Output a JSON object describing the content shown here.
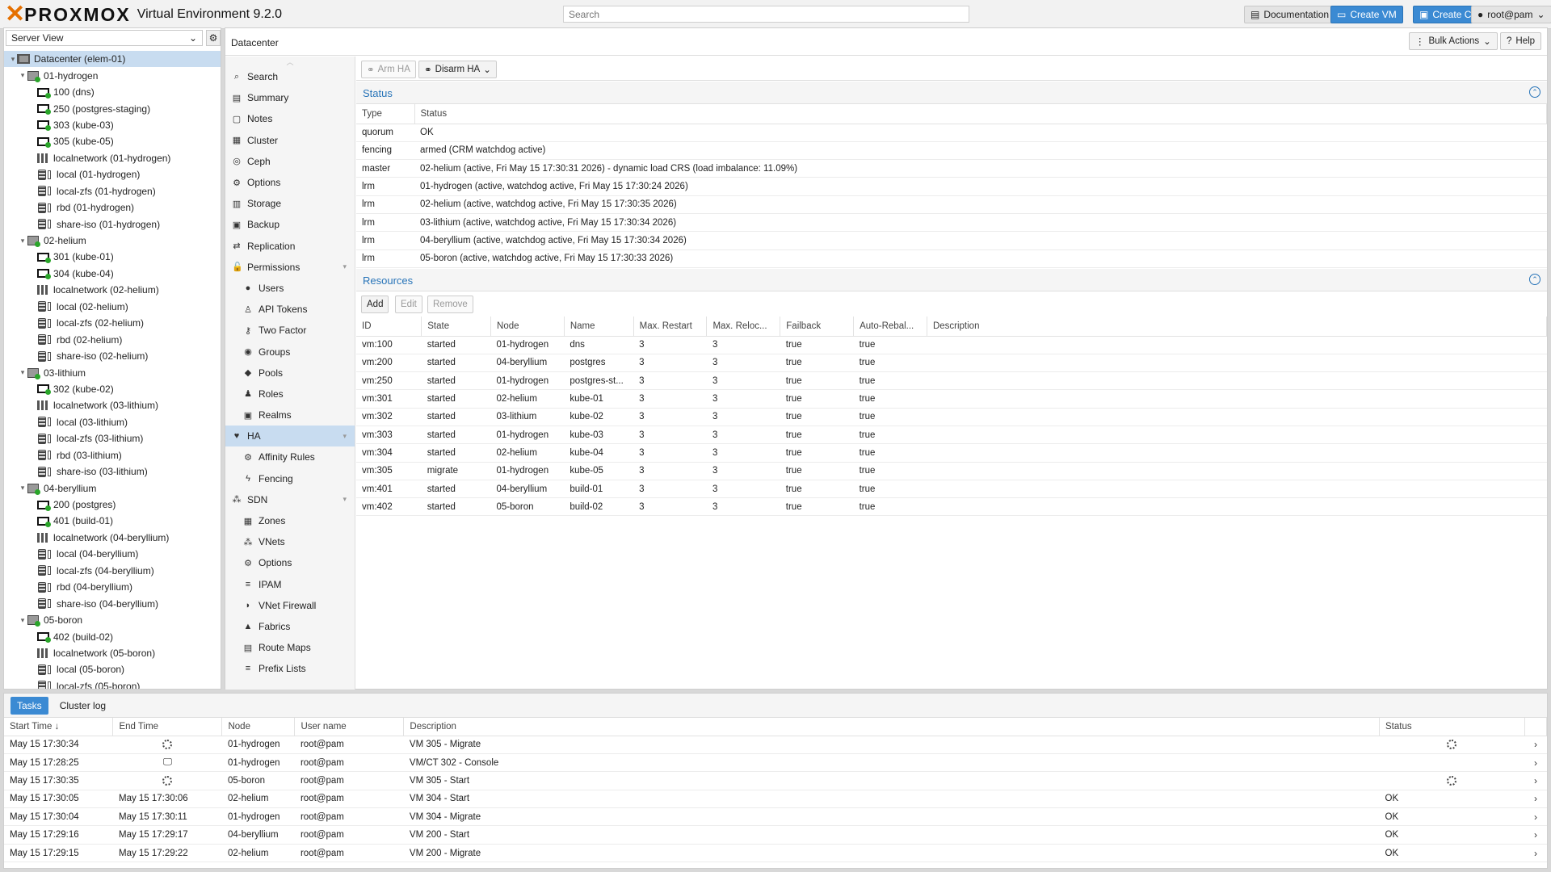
{
  "header": {
    "brand": "PROXMOX",
    "product": "Virtual Environment 9.2.0",
    "search_placeholder": "Search",
    "documentation": "Documentation",
    "create_vm": "Create VM",
    "create_ct": "Create CT",
    "user": "root@pam"
  },
  "tree": {
    "view": "Server View",
    "items": [
      {
        "label": "Datacenter (elem-01)",
        "type": "dc",
        "level": 0,
        "exp": "−",
        "sel": true
      },
      {
        "label": "01-hydrogen",
        "type": "node",
        "level": 1,
        "exp": "−"
      },
      {
        "label": "100 (dns)",
        "type": "vm",
        "level": 2
      },
      {
        "label": "250 (postgres-staging)",
        "type": "vm",
        "level": 2
      },
      {
        "label": "303 (kube-03)",
        "type": "vm",
        "level": 2
      },
      {
        "label": "305 (kube-05)",
        "type": "vm",
        "level": 2
      },
      {
        "label": "localnetwork (01-hydrogen)",
        "type": "net",
        "level": 2
      },
      {
        "label": "local (01-hydrogen)",
        "type": "stor",
        "level": 2
      },
      {
        "label": "local-zfs (01-hydrogen)",
        "type": "stor",
        "level": 2
      },
      {
        "label": "rbd (01-hydrogen)",
        "type": "stor",
        "level": 2
      },
      {
        "label": "share-iso (01-hydrogen)",
        "type": "stor",
        "level": 2
      },
      {
        "label": "02-helium",
        "type": "node",
        "level": 1,
        "exp": "−"
      },
      {
        "label": "301 (kube-01)",
        "type": "vm",
        "level": 2
      },
      {
        "label": "304 (kube-04)",
        "type": "vm",
        "level": 2
      },
      {
        "label": "localnetwork (02-helium)",
        "type": "net",
        "level": 2
      },
      {
        "label": "local (02-helium)",
        "type": "stor",
        "level": 2
      },
      {
        "label": "local-zfs (02-helium)",
        "type": "stor",
        "level": 2
      },
      {
        "label": "rbd (02-helium)",
        "type": "stor",
        "level": 2
      },
      {
        "label": "share-iso (02-helium)",
        "type": "stor",
        "level": 2
      },
      {
        "label": "03-lithium",
        "type": "node",
        "level": 1,
        "exp": "−"
      },
      {
        "label": "302 (kube-02)",
        "type": "vm",
        "level": 2
      },
      {
        "label": "localnetwork (03-lithium)",
        "type": "net",
        "level": 2
      },
      {
        "label": "local (03-lithium)",
        "type": "stor",
        "level": 2
      },
      {
        "label": "local-zfs (03-lithium)",
        "type": "stor",
        "level": 2
      },
      {
        "label": "rbd (03-lithium)",
        "type": "stor",
        "level": 2
      },
      {
        "label": "share-iso (03-lithium)",
        "type": "stor",
        "level": 2
      },
      {
        "label": "04-beryllium",
        "type": "node",
        "level": 1,
        "exp": "−"
      },
      {
        "label": "200 (postgres)",
        "type": "vm",
        "level": 2
      },
      {
        "label": "401 (build-01)",
        "type": "vm",
        "level": 2
      },
      {
        "label": "localnetwork (04-beryllium)",
        "type": "net",
        "level": 2
      },
      {
        "label": "local (04-beryllium)",
        "type": "stor",
        "level": 2
      },
      {
        "label": "local-zfs (04-beryllium)",
        "type": "stor",
        "level": 2
      },
      {
        "label": "rbd (04-beryllium)",
        "type": "stor",
        "level": 2
      },
      {
        "label": "share-iso (04-beryllium)",
        "type": "stor",
        "level": 2
      },
      {
        "label": "05-boron",
        "type": "node",
        "level": 1,
        "exp": "−"
      },
      {
        "label": "402 (build-02)",
        "type": "vm",
        "level": 2
      },
      {
        "label": "localnetwork (05-boron)",
        "type": "net",
        "level": 2
      },
      {
        "label": "local (05-boron)",
        "type": "stor",
        "level": 2
      },
      {
        "label": "local-zfs (05-boron)",
        "type": "stor",
        "level": 2
      }
    ]
  },
  "content": {
    "title": "Datacenter",
    "bulk_actions": "Bulk Actions",
    "help": "Help"
  },
  "menu": [
    {
      "label": "Search",
      "icon": "⌕"
    },
    {
      "label": "Summary",
      "icon": "▤"
    },
    {
      "label": "Notes",
      "icon": "▢"
    },
    {
      "label": "Cluster",
      "icon": "▦"
    },
    {
      "label": "Ceph",
      "icon": "◎"
    },
    {
      "label": "Options",
      "icon": "⚙"
    },
    {
      "label": "Storage",
      "icon": "▥"
    },
    {
      "label": "Backup",
      "icon": "▣"
    },
    {
      "label": "Replication",
      "icon": "⇄"
    },
    {
      "label": "Permissions",
      "icon": "🔓",
      "exp": "▾"
    },
    {
      "label": "Users",
      "icon": "●",
      "sub": true
    },
    {
      "label": "API Tokens",
      "icon": "♙",
      "sub": true
    },
    {
      "label": "Two Factor",
      "icon": "⚷",
      "sub": true
    },
    {
      "label": "Groups",
      "icon": "◉",
      "sub": true
    },
    {
      "label": "Pools",
      "icon": "◆",
      "sub": true
    },
    {
      "label": "Roles",
      "icon": "♟",
      "sub": true
    },
    {
      "label": "Realms",
      "icon": "▣",
      "sub": true
    },
    {
      "label": "HA",
      "icon": "♥",
      "exp": "▾",
      "sel": true
    },
    {
      "label": "Affinity Rules",
      "icon": "⚙",
      "sub": true
    },
    {
      "label": "Fencing",
      "icon": "ϟ",
      "sub": true
    },
    {
      "label": "SDN",
      "icon": "⁂",
      "exp": "▾"
    },
    {
      "label": "Zones",
      "icon": "▦",
      "sub": true
    },
    {
      "label": "VNets",
      "icon": "⁂",
      "sub": true
    },
    {
      "label": "Options",
      "icon": "⚙",
      "sub": true
    },
    {
      "label": "IPAM",
      "icon": "≡",
      "sub": true
    },
    {
      "label": "VNet Firewall",
      "icon": "◗",
      "sub": true
    },
    {
      "label": "Fabrics",
      "icon": "▲",
      "sub": true
    },
    {
      "label": "Route Maps",
      "icon": "▤",
      "sub": true
    },
    {
      "label": "Prefix Lists",
      "icon": "≡",
      "sub": true
    }
  ],
  "ha": {
    "arm": "Arm HA",
    "disarm": "Disarm HA",
    "status_title": "Status",
    "status_cols": [
      "Type",
      "Status"
    ],
    "status_rows": [
      [
        "quorum",
        "OK"
      ],
      [
        "fencing",
        "armed (CRM watchdog active)"
      ],
      [
        "master",
        "02-helium (active, Fri May 15 17:30:31 2026) - dynamic load CRS (load imbalance: 11.09%)"
      ],
      [
        "lrm",
        "01-hydrogen (active, watchdog active, Fri May 15 17:30:24 2026)"
      ],
      [
        "lrm",
        "02-helium (active, watchdog active, Fri May 15 17:30:35 2026)"
      ],
      [
        "lrm",
        "03-lithium (active, watchdog active, Fri May 15 17:30:34 2026)"
      ],
      [
        "lrm",
        "04-beryllium (active, watchdog active, Fri May 15 17:30:34 2026)"
      ],
      [
        "lrm",
        "05-boron (active, watchdog active, Fri May 15 17:30:33 2026)"
      ]
    ],
    "resources_title": "Resources",
    "add": "Add",
    "edit": "Edit",
    "remove": "Remove",
    "res_cols": [
      "ID",
      "State",
      "Node",
      "Name",
      "Max. Restart",
      "Max. Reloc...",
      "Failback",
      "Auto-Rebal...",
      "Description"
    ],
    "res_rows": [
      [
        "vm:100",
        "started",
        "01-hydrogen",
        "dns",
        "3",
        "3",
        "true",
        "true",
        ""
      ],
      [
        "vm:200",
        "started",
        "04-beryllium",
        "postgres",
        "3",
        "3",
        "true",
        "true",
        ""
      ],
      [
        "vm:250",
        "started",
        "01-hydrogen",
        "postgres-st...",
        "3",
        "3",
        "true",
        "true",
        ""
      ],
      [
        "vm:301",
        "started",
        "02-helium",
        "kube-01",
        "3",
        "3",
        "true",
        "true",
        ""
      ],
      [
        "vm:302",
        "started",
        "03-lithium",
        "kube-02",
        "3",
        "3",
        "true",
        "true",
        ""
      ],
      [
        "vm:303",
        "started",
        "01-hydrogen",
        "kube-03",
        "3",
        "3",
        "true",
        "true",
        ""
      ],
      [
        "vm:304",
        "started",
        "02-helium",
        "kube-04",
        "3",
        "3",
        "true",
        "true",
        ""
      ],
      [
        "vm:305",
        "migrate",
        "01-hydrogen",
        "kube-05",
        "3",
        "3",
        "true",
        "true",
        ""
      ],
      [
        "vm:401",
        "started",
        "04-beryllium",
        "build-01",
        "3",
        "3",
        "true",
        "true",
        ""
      ],
      [
        "vm:402",
        "started",
        "05-boron",
        "build-02",
        "3",
        "3",
        "true",
        "true",
        ""
      ]
    ]
  },
  "tasks": {
    "tab_tasks": "Tasks",
    "tab_cluster_log": "Cluster log",
    "cols": [
      "Start Time ↓",
      "End Time",
      "Node",
      "User name",
      "Description",
      "Status"
    ],
    "rows": [
      {
        "start": "May 15 17:30:34",
        "end": "",
        "end_icon": "spinner",
        "node": "01-hydrogen",
        "user": "root@pam",
        "desc": "VM 305 - Migrate",
        "status": "",
        "status_icon": "spinner"
      },
      {
        "start": "May 15 17:28:25",
        "end": "",
        "end_icon": "monitor",
        "node": "01-hydrogen",
        "user": "root@pam",
        "desc": "VM/CT 302 - Console",
        "status": ""
      },
      {
        "start": "May 15 17:30:35",
        "end": "",
        "end_icon": "spinner",
        "node": "05-boron",
        "user": "root@pam",
        "desc": "VM 305 - Start",
        "status": "",
        "status_icon": "spinner"
      },
      {
        "start": "May 15 17:30:05",
        "end": "May 15 17:30:06",
        "node": "02-helium",
        "user": "root@pam",
        "desc": "VM 304 - Start",
        "status": "OK"
      },
      {
        "start": "May 15 17:30:04",
        "end": "May 15 17:30:11",
        "node": "01-hydrogen",
        "user": "root@pam",
        "desc": "VM 304 - Migrate",
        "status": "OK"
      },
      {
        "start": "May 15 17:29:16",
        "end": "May 15 17:29:17",
        "node": "04-beryllium",
        "user": "root@pam",
        "desc": "VM 200 - Start",
        "status": "OK"
      },
      {
        "start": "May 15 17:29:15",
        "end": "May 15 17:29:22",
        "node": "02-helium",
        "user": "root@pam",
        "desc": "VM 200 - Migrate",
        "status": "OK"
      }
    ]
  }
}
